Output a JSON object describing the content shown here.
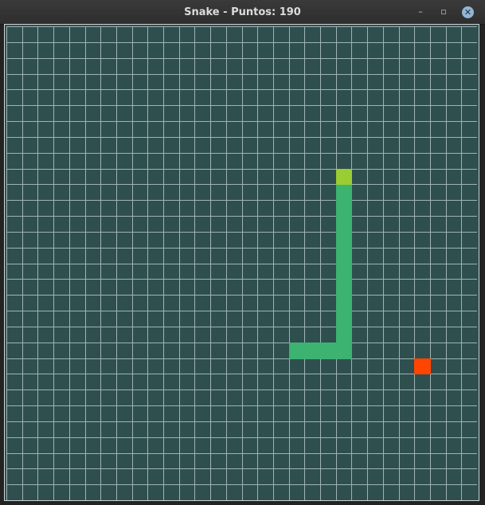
{
  "window": {
    "title": "Snake - Puntos: 190",
    "controls": {
      "minimize": "–",
      "maximize": "▫",
      "close": "✕"
    }
  },
  "game": {
    "grid_cols": 30,
    "grid_rows": 30,
    "colors": {
      "background": "#2f4f4f",
      "grid_line": "#9fb3b3",
      "snake_body": "#3cb371",
      "snake_head": "#9acd32",
      "food": "#ff4500"
    },
    "snake": {
      "head": [
        21,
        9
      ],
      "body": [
        [
          21,
          10
        ],
        [
          21,
          11
        ],
        [
          21,
          12
        ],
        [
          21,
          13
        ],
        [
          21,
          14
        ],
        [
          21,
          15
        ],
        [
          21,
          16
        ],
        [
          21,
          17
        ],
        [
          21,
          18
        ],
        [
          21,
          19
        ],
        [
          21,
          20
        ],
        [
          20,
          20
        ],
        [
          19,
          20
        ],
        [
          18,
          20
        ]
      ]
    },
    "food": [
      26,
      21
    ]
  }
}
